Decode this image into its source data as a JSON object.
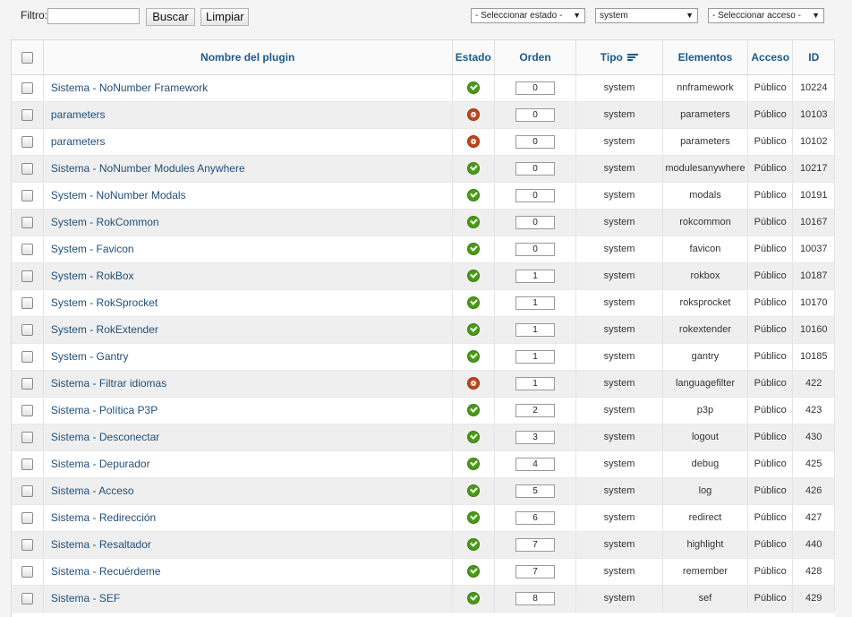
{
  "filter": {
    "label": "Filtro:",
    "value": "",
    "search_label": "Buscar",
    "clear_label": "Limpiar"
  },
  "selects": {
    "state": "- Seleccionar estado -",
    "type": "system",
    "access": "- Seleccionar acceso -"
  },
  "columns": {
    "name": "Nombre del plugin",
    "state": "Estado",
    "order": "Orden",
    "type": "Tipo",
    "elements": "Elementos",
    "access": "Acceso",
    "id": "ID"
  },
  "rows": [
    {
      "name": "Sistema - NoNumber Framework",
      "enabled": true,
      "order": "0",
      "type": "system",
      "element": "nnframework",
      "access": "Público",
      "id": "10224"
    },
    {
      "name": "parameters",
      "enabled": false,
      "order": "0",
      "type": "system",
      "element": "parameters",
      "access": "Público",
      "id": "10103"
    },
    {
      "name": "parameters",
      "enabled": false,
      "order": "0",
      "type": "system",
      "element": "parameters",
      "access": "Público",
      "id": "10102"
    },
    {
      "name": "Sistema - NoNumber Modules Anywhere",
      "enabled": true,
      "order": "0",
      "type": "system",
      "element": "modulesanywhere",
      "access": "Público",
      "id": "10217"
    },
    {
      "name": "System - NoNumber Modals",
      "enabled": true,
      "order": "0",
      "type": "system",
      "element": "modals",
      "access": "Público",
      "id": "10191"
    },
    {
      "name": "System - RokCommon",
      "enabled": true,
      "order": "0",
      "type": "system",
      "element": "rokcommon",
      "access": "Público",
      "id": "10167"
    },
    {
      "name": "System - Favicon",
      "enabled": true,
      "order": "0",
      "type": "system",
      "element": "favicon",
      "access": "Público",
      "id": "10037"
    },
    {
      "name": "System - RokBox",
      "enabled": true,
      "order": "1",
      "type": "system",
      "element": "rokbox",
      "access": "Público",
      "id": "10187"
    },
    {
      "name": "System - RokSprocket",
      "enabled": true,
      "order": "1",
      "type": "system",
      "element": "roksprocket",
      "access": "Público",
      "id": "10170"
    },
    {
      "name": "System - RokExtender",
      "enabled": true,
      "order": "1",
      "type": "system",
      "element": "rokextender",
      "access": "Público",
      "id": "10160"
    },
    {
      "name": "System - Gantry",
      "enabled": true,
      "order": "1",
      "type": "system",
      "element": "gantry",
      "access": "Público",
      "id": "10185"
    },
    {
      "name": "Sistema - Filtrar idiomas",
      "enabled": false,
      "order": "1",
      "type": "system",
      "element": "languagefilter",
      "access": "Público",
      "id": "422"
    },
    {
      "name": "Sistema - Política P3P",
      "enabled": true,
      "order": "2",
      "type": "system",
      "element": "p3p",
      "access": "Público",
      "id": "423"
    },
    {
      "name": "Sistema - Desconectar",
      "enabled": true,
      "order": "3",
      "type": "system",
      "element": "logout",
      "access": "Público",
      "id": "430"
    },
    {
      "name": "Sistema - Depurador",
      "enabled": true,
      "order": "4",
      "type": "system",
      "element": "debug",
      "access": "Público",
      "id": "425"
    },
    {
      "name": "Sistema - Acceso",
      "enabled": true,
      "order": "5",
      "type": "system",
      "element": "log",
      "access": "Público",
      "id": "426"
    },
    {
      "name": "Sistema - Redirección",
      "enabled": true,
      "order": "6",
      "type": "system",
      "element": "redirect",
      "access": "Público",
      "id": "427"
    },
    {
      "name": "Sistema - Resaltador",
      "enabled": true,
      "order": "7",
      "type": "system",
      "element": "highlight",
      "access": "Público",
      "id": "440"
    },
    {
      "name": "Sistema - Recuérdeme",
      "enabled": true,
      "order": "7",
      "type": "system",
      "element": "remember",
      "access": "Público",
      "id": "428"
    },
    {
      "name": "Sistema - SEF",
      "enabled": true,
      "order": "8",
      "type": "system",
      "element": "sef",
      "access": "Público",
      "id": "429"
    }
  ],
  "colors": {
    "link": "#1f4e79",
    "header": "#1b5a8a",
    "enabled": "#4b9a16",
    "disabled": "#c0461c"
  }
}
